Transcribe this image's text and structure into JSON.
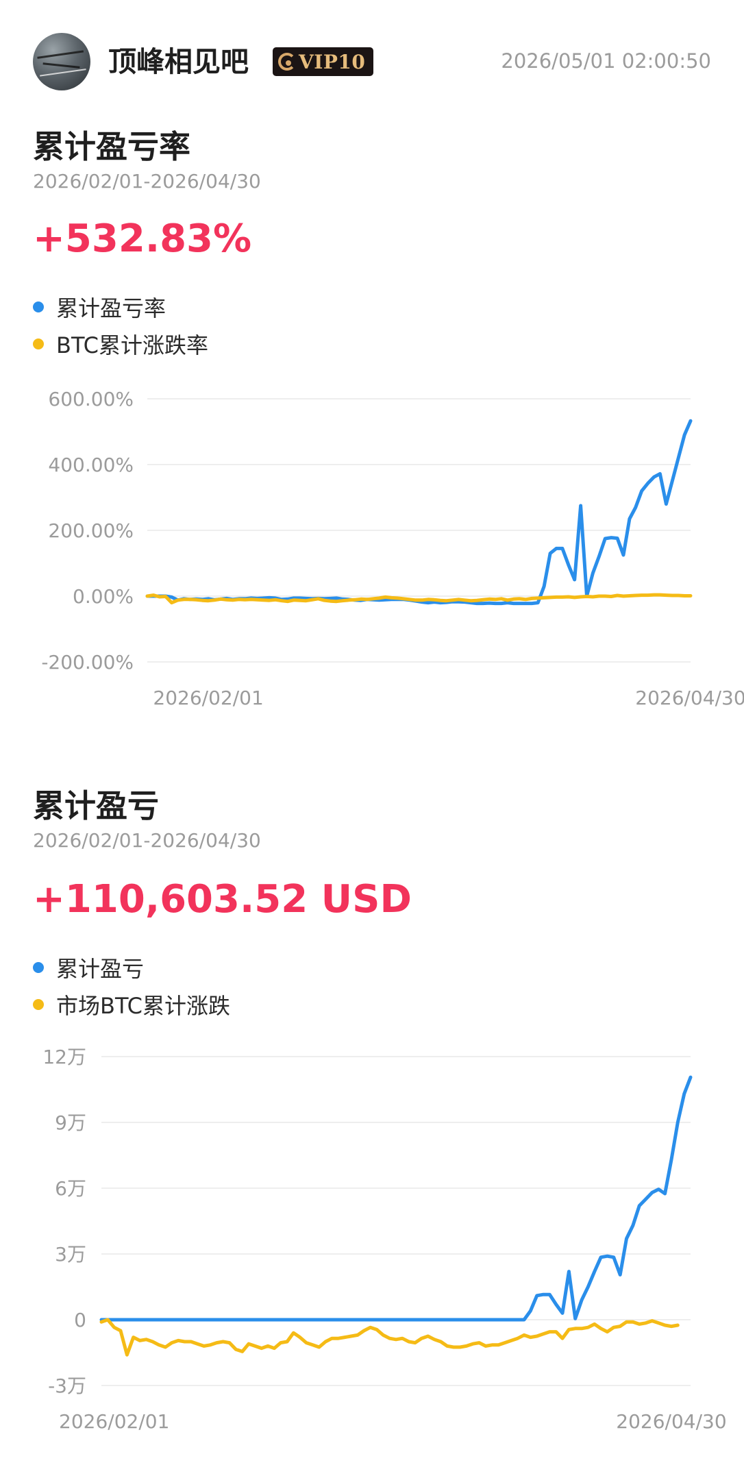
{
  "header": {
    "username": "顶峰相见吧",
    "vip_label": "VIP10",
    "timestamp": "2026/05/01 02:00:50"
  },
  "sections": [
    {
      "title": "累计盈亏率",
      "range": "2026/02/01-2026/04/30",
      "value": "+532.83%",
      "legend": [
        "累计盈亏率",
        "BTC累计涨跌率"
      ]
    },
    {
      "title": "累计盈亏",
      "range": "2026/02/01-2026/04/30",
      "value": "+110,603.52 USD",
      "legend": [
        "累计盈亏",
        "市场BTC累计涨跌"
      ]
    }
  ],
  "colors": {
    "series_primary": "#2a8eea",
    "series_btc": "#f5bb16",
    "value_red": "#f2335b"
  },
  "chart_data": [
    {
      "type": "line",
      "unit": "%",
      "y_ticks": [
        600,
        400,
        200,
        0,
        -200
      ],
      "y_tick_labels": [
        "600.00%",
        "400.00%",
        "200.00%",
        "0.00%",
        "-200.00%"
      ],
      "ylim": [
        -200,
        600
      ],
      "x_tick_labels": [
        "2026/02/01",
        "2026/04/30"
      ],
      "x_tick_positions": [
        10,
        89
      ],
      "grid": true,
      "legend_position": "top-left",
      "series": [
        {
          "name": "累计盈亏率",
          "color": "#2a8eea",
          "values": [
            0,
            0,
            0,
            0,
            -3,
            -12,
            -8,
            -10,
            -9,
            -10,
            -8,
            -11,
            -9,
            -7,
            -10,
            -8,
            -8,
            -6,
            -7,
            -6,
            -5,
            -6,
            -10,
            -9,
            -6,
            -6,
            -7,
            -8,
            -7,
            -8,
            -7,
            -6,
            -9,
            -10,
            -12,
            -13,
            -10,
            -11,
            -12,
            -11,
            -10,
            -10,
            -10,
            -12,
            -15,
            -18,
            -20,
            -18,
            -20,
            -19,
            -17,
            -17,
            -18,
            -20,
            -22,
            -22,
            -21,
            -22,
            -22,
            -20,
            -22,
            -22,
            -22,
            -22,
            -20,
            30,
            130,
            145,
            145,
            95,
            50,
            275,
            0,
            70,
            120,
            175,
            178,
            176,
            125,
            235,
            270,
            320,
            343,
            362,
            372,
            280,
            350,
            420,
            490,
            533
          ]
        },
        {
          "name": "BTC累计涨跌率",
          "color": "#f5bb16",
          "values": [
            0,
            3,
            -2,
            -1,
            -20,
            -12,
            -10,
            -10,
            -11,
            -13,
            -14,
            -12,
            -9,
            -11,
            -12,
            -10,
            -11,
            -10,
            -11,
            -12,
            -13,
            -11,
            -14,
            -16,
            -12,
            -13,
            -14,
            -11,
            -8,
            -13,
            -15,
            -16,
            -14,
            -12,
            -11,
            -9,
            -10,
            -8,
            -6,
            -3,
            -5,
            -6,
            -8,
            -10,
            -12,
            -12,
            -10,
            -11,
            -13,
            -14,
            -12,
            -10,
            -12,
            -14,
            -13,
            -11,
            -9,
            -10,
            -8,
            -12,
            -9,
            -8,
            -10,
            -7,
            -6,
            -5,
            -4,
            -3,
            -3,
            -2,
            -4,
            -2,
            -1,
            -2,
            0,
            0,
            -1,
            2,
            0,
            1,
            2,
            3,
            3,
            4,
            4,
            3,
            2,
            2,
            1,
            1
          ]
        }
      ]
    },
    {
      "type": "line",
      "unit": "万",
      "y_ticks": [
        12,
        9,
        6,
        3,
        0,
        -3
      ],
      "y_tick_labels": [
        "12万",
        "9万",
        "6万",
        "3万",
        "0",
        "-3万"
      ],
      "ylim": [
        -3,
        12
      ],
      "x_tick_labels": [
        "2026/02/01",
        "2026/04/30"
      ],
      "x_tick_positions": [
        2,
        89
      ],
      "grid": true,
      "legend_position": "top-left",
      "series": [
        {
          "name": "累计盈亏",
          "color": "#2a8eea",
          "values": [
            0,
            0,
            0,
            0,
            0,
            0,
            0,
            0,
            0,
            0,
            0,
            0,
            0,
            0,
            0,
            0,
            0,
            0,
            0,
            0,
            0,
            0,
            0,
            0,
            0,
            0,
            0,
            0,
            0,
            0,
            0,
            0,
            0,
            0,
            0,
            0,
            0,
            0,
            0,
            0,
            0,
            0,
            0,
            0,
            0,
            0,
            0,
            0,
            0,
            0,
            0,
            0,
            0,
            0,
            0,
            0,
            0,
            0,
            0,
            0,
            0,
            0,
            0,
            0,
            0,
            0,
            0,
            0.4,
            1.1,
            1.15,
            1.15,
            0.7,
            0.3,
            2.2,
            0.05,
            0.9,
            1.5,
            2.2,
            2.85,
            2.9,
            2.85,
            2.05,
            3.7,
            4.3,
            5.2,
            5.5,
            5.8,
            5.95,
            5.75,
            7.3,
            9.0,
            10.3,
            11.06
          ]
        },
        {
          "name": "市场BTC累计涨跌",
          "color": "#f5bb16",
          "values": [
            -0.1,
            0.0,
            -0.35,
            -0.5,
            -1.6,
            -0.8,
            -0.95,
            -0.9,
            -1.0,
            -1.15,
            -1.25,
            -1.05,
            -0.95,
            -1.0,
            -1.0,
            -1.1,
            -1.2,
            -1.15,
            -1.05,
            -1.0,
            -1.05,
            -1.35,
            -1.45,
            -1.1,
            -1.2,
            -1.3,
            -1.2,
            -1.3,
            -1.05,
            -1.0,
            -0.6,
            -0.8,
            -1.05,
            -1.15,
            -1.25,
            -1.0,
            -0.85,
            -0.85,
            -0.8,
            -0.75,
            -0.7,
            -0.5,
            -0.35,
            -0.45,
            -0.7,
            -0.85,
            -0.9,
            -0.85,
            -1.0,
            -1.05,
            -0.85,
            -0.75,
            -0.9,
            -1.0,
            -1.2,
            -1.25,
            -1.25,
            -1.2,
            -1.1,
            -1.05,
            -1.2,
            -1.15,
            -1.15,
            -1.05,
            -0.95,
            -0.85,
            -0.7,
            -0.8,
            -0.75,
            -0.65,
            -0.55,
            -0.55,
            -0.85,
            -0.45,
            -0.4,
            -0.4,
            -0.35,
            -0.2,
            -0.4,
            -0.55,
            -0.35,
            -0.3,
            -0.1,
            -0.1,
            -0.2,
            -0.15,
            -0.05,
            -0.15,
            -0.25,
            -0.3,
            -0.25
          ]
        }
      ]
    }
  ]
}
